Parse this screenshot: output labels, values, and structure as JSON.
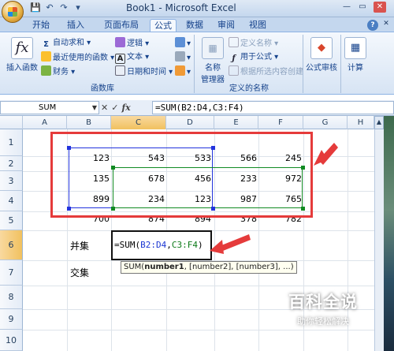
{
  "window": {
    "title": "Book1 - Microsoft Excel",
    "minimize": "—",
    "restore": "▭",
    "close": "✕",
    "help": "?"
  },
  "quick_access": {
    "save_icon": "💾",
    "undo_icon": "↶",
    "redo_icon": "↷",
    "dropdown_icon": "▾"
  },
  "ribbon_tabs": [
    "开始",
    "插入",
    "页面布局",
    "公式",
    "数据",
    "审阅",
    "视图"
  ],
  "active_tab": "公式",
  "ribbon": {
    "function_library": {
      "group_label": "函数库",
      "insert_function": "插入函数",
      "insert_function_glyph": "fx",
      "autosum": "自动求和",
      "recently_used": "最近使用的函数",
      "financial": "财务",
      "logical": "逻辑",
      "text": "文本",
      "date_time": "日期和时间"
    },
    "defined_names": {
      "group_label": "定义的名称",
      "name_manager_line1": "名称",
      "name_manager_line2": "管理器",
      "define_name": "定义名称",
      "use_in_formula": "用于公式",
      "create_from_selection": "根据所选内容创建"
    },
    "formula_auditing": {
      "label": "公式审核"
    },
    "calculation": {
      "label": "计算"
    }
  },
  "formula_bar": {
    "name_box": "SUM",
    "cancel": "✕",
    "enter": "✓",
    "fx": "fx",
    "formula": "=SUM(B2:D4,C3:F4)"
  },
  "columns": [
    "A",
    "B",
    "C",
    "D",
    "E",
    "F",
    "G",
    "H"
  ],
  "rows": [
    "1",
    "2",
    "3",
    "4",
    "5",
    "6",
    "7",
    "8",
    "9",
    "10"
  ],
  "cells": {
    "row2": [
      "123",
      "543",
      "533",
      "566",
      "245"
    ],
    "row3": [
      "135",
      "678",
      "456",
      "233",
      "972"
    ],
    "row4": [
      "899",
      "234",
      "123",
      "987",
      "765"
    ],
    "row5": [
      "700",
      "874",
      "894",
      "378",
      "782"
    ]
  },
  "labels": {
    "union": "并集",
    "intersection": "交集"
  },
  "edit_cell": {
    "prefix": "=SUM(",
    "ref1": "B2:D4",
    "sep": ",",
    "ref2": "C3:F4",
    "suffix": ")"
  },
  "tooltip": {
    "fn": "SUM(",
    "arg1": "number1",
    "rest": ", [number2], [number3], ...)"
  },
  "watermark": {
    "title": "百科全说",
    "subtitle": "助你轻松解决"
  },
  "colors": {
    "annotation_red": "#e53b3b",
    "ref_blue": "#1a36d2",
    "ref_green": "#0c7a18"
  }
}
